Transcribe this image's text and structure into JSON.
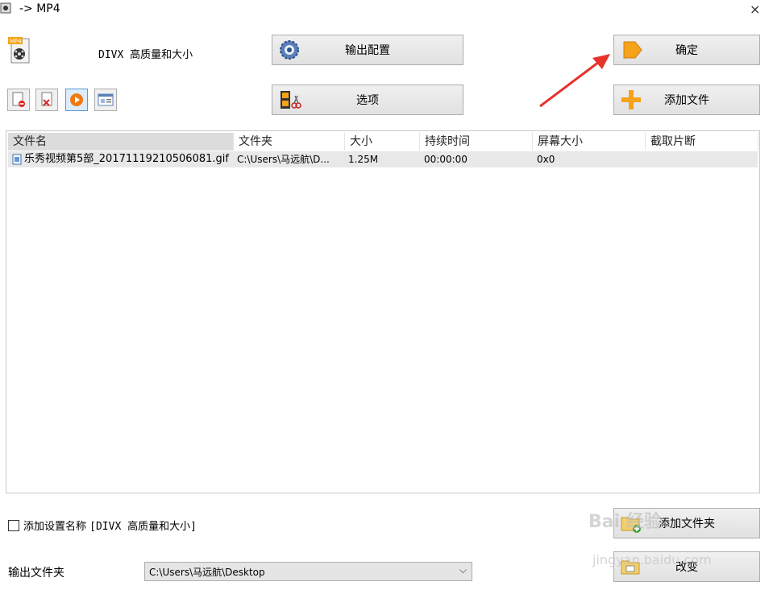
{
  "window": {
    "title": "-> MP4",
    "close_label": "×"
  },
  "profile": {
    "name": "DIVX 高质量和大小",
    "icon_label": "MP4"
  },
  "buttons": {
    "output_config": "输出配置",
    "ok": "确定",
    "options": "选项",
    "add_file": "添加文件",
    "add_folder": "添加文件夹",
    "change": "改变"
  },
  "file_list": {
    "columns": [
      "文件名",
      "文件夹",
      "大小",
      "持续时间",
      "屏幕大小",
      "截取片断"
    ],
    "rows": [
      {
        "name": "乐秀视频第5部_20171119210506081.gif",
        "folder": "C:\\Users\\马远航\\D...",
        "size": "1.25M",
        "duration": "00:00:00",
        "screen": "0x0",
        "clip": ""
      }
    ]
  },
  "add_setting": {
    "label": "添加设置名称",
    "value": "[DIVX 高质量和大小]",
    "checked": false
  },
  "output_folder": {
    "label": "输出文件夹",
    "value": "C:\\Users\\马远航\\Desktop",
    "arrow": "⌵"
  },
  "watermark": {
    "main": "Bai 经验",
    "sub": "jingyan.baidu.com"
  },
  "colors": {
    "accent_arrow": "#e8332c",
    "orange": "#f5a31a"
  }
}
